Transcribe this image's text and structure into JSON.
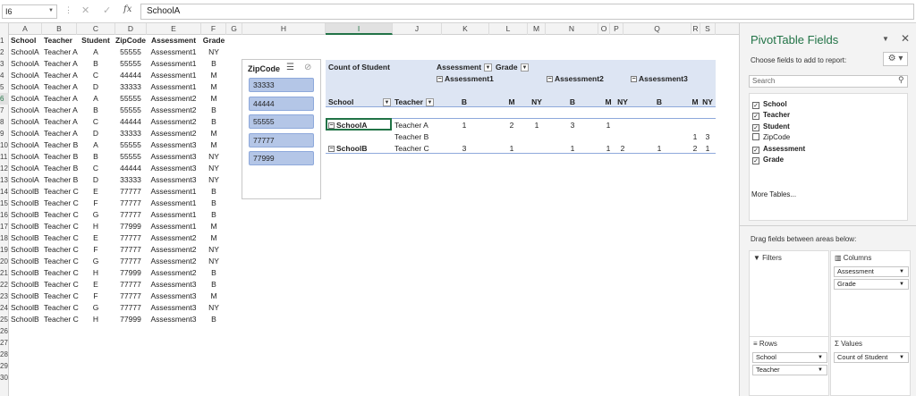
{
  "formula_bar": {
    "name_box": "I6",
    "formula": "SchoolA",
    "fx": "fx",
    "cancel": "✕",
    "enter": "✓",
    "more": "⋮"
  },
  "columns": [
    "A",
    "B",
    "C",
    "D",
    "E",
    "F",
    "G",
    "H",
    "I",
    "J",
    "K",
    "L",
    "M",
    "N",
    "O",
    "P",
    "Q",
    "R",
    "S"
  ],
  "rows": [
    "1",
    "2",
    "3",
    "4",
    "5",
    "6",
    "7",
    "8",
    "9",
    "10",
    "11",
    "12",
    "13",
    "14",
    "15",
    "16",
    "17",
    "18",
    "19",
    "20",
    "21",
    "22",
    "23",
    "24",
    "25",
    "26",
    "27",
    "28",
    "29",
    "30"
  ],
  "table": {
    "headers": [
      "School",
      "Teacher",
      "Student",
      "ZipCode",
      "Assessment",
      "Grade"
    ],
    "rows": [
      [
        "SchoolA",
        "Teacher A",
        "A",
        "55555",
        "Assessment1",
        "NY"
      ],
      [
        "SchoolA",
        "Teacher A",
        "B",
        "55555",
        "Assessment1",
        "B"
      ],
      [
        "SchoolA",
        "Teacher A",
        "C",
        "44444",
        "Assessment1",
        "M"
      ],
      [
        "SchoolA",
        "Teacher A",
        "D",
        "33333",
        "Assessment1",
        "M"
      ],
      [
        "SchoolA",
        "Teacher A",
        "A",
        "55555",
        "Assessment2",
        "M"
      ],
      [
        "SchoolA",
        "Teacher A",
        "B",
        "55555",
        "Assessment2",
        "B"
      ],
      [
        "SchoolA",
        "Teacher A",
        "C",
        "44444",
        "Assessment2",
        "B"
      ],
      [
        "SchoolA",
        "Teacher A",
        "D",
        "33333",
        "Assessment2",
        "M"
      ],
      [
        "SchoolA",
        "Teacher B",
        "A",
        "55555",
        "Assessment3",
        "M"
      ],
      [
        "SchoolA",
        "Teacher B",
        "B",
        "55555",
        "Assessment3",
        "NY"
      ],
      [
        "SchoolA",
        "Teacher B",
        "C",
        "44444",
        "Assessment3",
        "NY"
      ],
      [
        "SchoolA",
        "Teacher B",
        "D",
        "33333",
        "Assessment3",
        "NY"
      ],
      [
        "SchoolB",
        "Teacher C",
        "E",
        "77777",
        "Assessment1",
        "B"
      ],
      [
        "SchoolB",
        "Teacher C",
        "F",
        "77777",
        "Assessment1",
        "B"
      ],
      [
        "SchoolB",
        "Teacher C",
        "G",
        "77777",
        "Assessment1",
        "B"
      ],
      [
        "SchoolB",
        "Teacher C",
        "H",
        "77999",
        "Assessment1",
        "M"
      ],
      [
        "SchoolB",
        "Teacher C",
        "E",
        "77777",
        "Assessment2",
        "M"
      ],
      [
        "SchoolB",
        "Teacher C",
        "F",
        "77777",
        "Assessment2",
        "NY"
      ],
      [
        "SchoolB",
        "Teacher C",
        "G",
        "77777",
        "Assessment2",
        "NY"
      ],
      [
        "SchoolB",
        "Teacher C",
        "H",
        "77999",
        "Assessment2",
        "B"
      ],
      [
        "SchoolB",
        "Teacher C",
        "E",
        "77777",
        "Assessment3",
        "B"
      ],
      [
        "SchoolB",
        "Teacher C",
        "F",
        "77777",
        "Assessment3",
        "M"
      ],
      [
        "SchoolB",
        "Teacher C",
        "G",
        "77777",
        "Assessment3",
        "NY"
      ],
      [
        "SchoolB",
        "Teacher C",
        "H",
        "77999",
        "Assessment3",
        "B"
      ]
    ]
  },
  "slicer": {
    "title": "ZipCode",
    "multi_icon": "☰",
    "clear_icon": "⊘",
    "items": [
      "33333",
      "44444",
      "55555",
      "77777",
      "77999"
    ]
  },
  "pivot": {
    "value_label": "Count of Student",
    "col_field1": "Assessment",
    "col_field2": "Grade",
    "row_field1": "School",
    "row_field2": "Teacher",
    "assessments": [
      "Assessment1",
      "Assessment2",
      "Assessment3"
    ],
    "grades": {
      "a1": [
        "B",
        "M",
        "NY"
      ],
      "a2": [
        "B",
        "M",
        "NY"
      ],
      "a3": [
        "B",
        "M",
        "NY"
      ]
    },
    "rows": [
      {
        "school": "SchoolA",
        "teacher": "Teacher A",
        "values": [
          "1",
          "2",
          "1",
          "3",
          "1",
          "",
          "",
          "",
          ""
        ]
      },
      {
        "school": "",
        "teacher": "Teacher B",
        "values": [
          "",
          "",
          "",
          "",
          "",
          "",
          "",
          "1",
          "3"
        ]
      },
      {
        "school": "SchoolB",
        "teacher": "Teacher C",
        "values": [
          "3",
          "1",
          "",
          "1",
          "1",
          "2",
          "1",
          "2",
          "1"
        ]
      }
    ]
  },
  "pane": {
    "title": "PivotTable Fields",
    "subtitle": "Choose fields to add to report:",
    "search_placeholder": "Search",
    "fields": [
      {
        "name": "School",
        "checked": true
      },
      {
        "name": "Teacher",
        "checked": true
      },
      {
        "name": "Student",
        "checked": true
      },
      {
        "name": "ZipCode",
        "checked": false
      },
      {
        "name": "Assessment",
        "checked": true
      },
      {
        "name": "Grade",
        "checked": true
      }
    ],
    "more_tables": "More Tables...",
    "drag_label": "Drag fields between areas below:",
    "areas": {
      "filters": {
        "label": "Filters",
        "items": []
      },
      "columns": {
        "label": "Columns",
        "items": [
          "Assessment",
          "Grade"
        ]
      },
      "rows": {
        "label": "Rows",
        "items": [
          "School",
          "Teacher"
        ]
      },
      "values": {
        "label": "Values",
        "items": [
          "Count of Student"
        ]
      }
    }
  }
}
